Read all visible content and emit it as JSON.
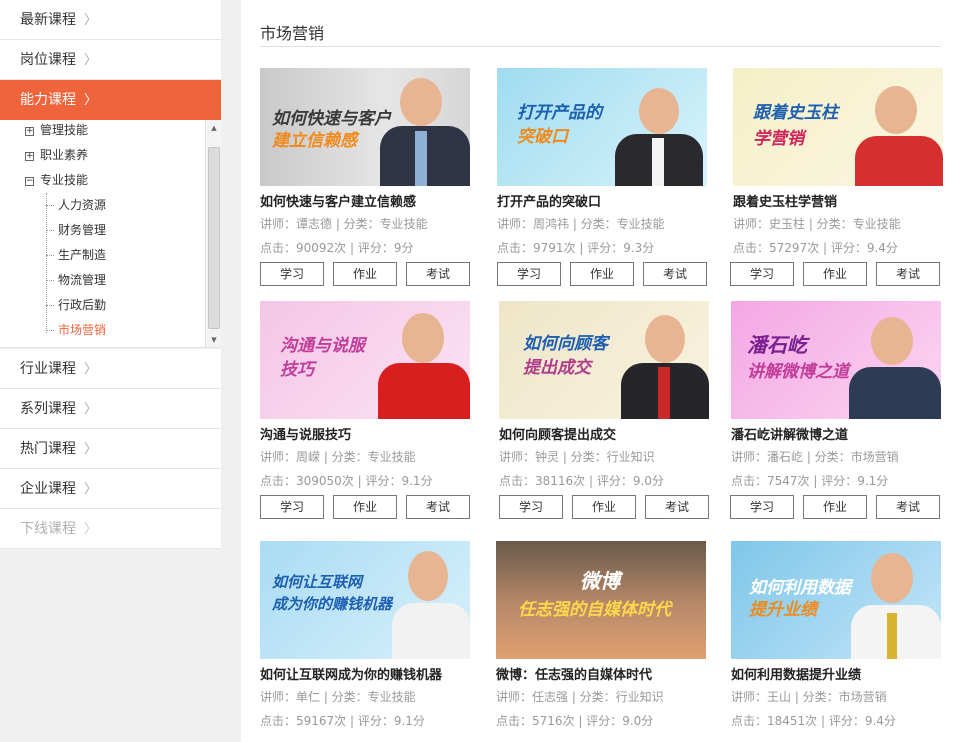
{
  "sidebar": {
    "menu": [
      {
        "label": "最新课程"
      },
      {
        "label": "岗位课程"
      },
      {
        "label": "能力课程"
      },
      {
        "label": "行业课程"
      },
      {
        "label": "系列课程"
      },
      {
        "label": "热门课程"
      },
      {
        "label": "企业课程"
      },
      {
        "label": "下线课程"
      }
    ],
    "tree": {
      "nodes": [
        {
          "label": "管理技能",
          "toggle": "+"
        },
        {
          "label": "职业素养",
          "toggle": "+"
        },
        {
          "label": "专业技能",
          "toggle": "−"
        }
      ],
      "leaves": [
        {
          "label": "人力资源"
        },
        {
          "label": "财务管理"
        },
        {
          "label": "生产制造"
        },
        {
          "label": "物流管理"
        },
        {
          "label": "行政后勤"
        },
        {
          "label": "市场营销"
        }
      ]
    }
  },
  "main": {
    "title": "市场营销",
    "buttons": {
      "study": "学习",
      "homework": "作业",
      "exam": "考试"
    },
    "courses": [
      {
        "title": "如何快速与客户建立信赖感",
        "meta": "讲师：谭志德 | 分类：专业技能",
        "stats": "点击：90092次 | 评分：9分",
        "img_line1": "如何快速与客户",
        "img_line2": "建立信赖感"
      },
      {
        "title": "打开产品的突破口",
        "meta": "讲师：周鸿祎 | 分类：专业技能",
        "stats": "点击：9791次 | 评分：9.3分",
        "img_line1": "打开产品的",
        "img_line2": "突破口"
      },
      {
        "title": "跟着史玉柱学营销",
        "meta": "讲师：史玉柱 | 分类：专业技能",
        "stats": "点击：57297次 | 评分：9.4分",
        "img_line1": "跟着史玉柱",
        "img_line2": "学营销"
      },
      {
        "title": "沟通与说服技巧",
        "meta": "讲师：周嵘 | 分类：专业技能",
        "stats": "点击：309050次 | 评分：9.1分",
        "img_line1": "沟通与说服",
        "img_line2": "技巧"
      },
      {
        "title": "如何向顾客提出成交",
        "meta": "讲师：钟灵 | 分类：行业知识",
        "stats": "点击：38116次 | 评分：9.0分",
        "img_line1": "如何向顾客",
        "img_line2": "提出成交"
      },
      {
        "title": "潘石屹讲解微博之道",
        "meta": "讲师：潘石屹 | 分类：市场营销",
        "stats": "点击：7547次 | 评分：9.1分",
        "img_line1": "潘石屹",
        "img_line2": "讲解微博之道"
      },
      {
        "title": "如何让互联网成为你的赚钱机器",
        "meta": "讲师：单仁 | 分类：专业技能",
        "stats": "点击：59167次 | 评分：9.1分",
        "img_line1": "如何让互联网",
        "img_line2": "成为你的赚钱机器"
      },
      {
        "title": "微博：任志强的自媒体时代",
        "meta": "讲师：任志强 | 分类：行业知识",
        "stats": "点击：5716次 | 评分：9.0分",
        "img_line1": "微博",
        "img_line2": "任志强的自媒体时代"
      },
      {
        "title": "如何利用数据提升业绩",
        "meta": "讲师：王山 | 分类：市场营销",
        "stats": "点击：18451次 | 评分：9.4分",
        "img_line1": "如何利用数据",
        "img_line2": "提升业绩"
      }
    ]
  },
  "colors": {
    "accent": "#f0643c",
    "sidebar_bg": "#f0f0f0"
  }
}
